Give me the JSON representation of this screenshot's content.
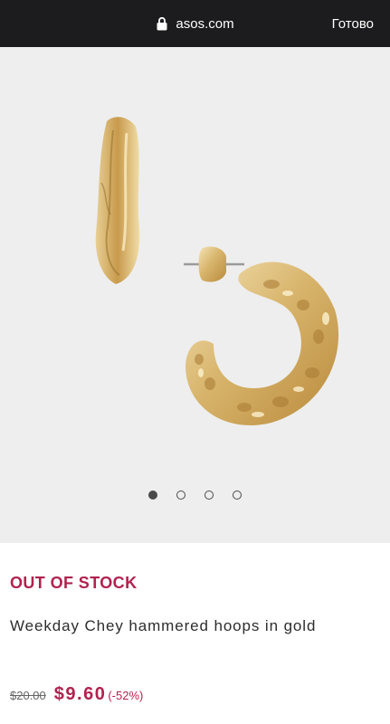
{
  "browser": {
    "url": "asos.com",
    "done_label": "Готово",
    "lock_icon": "lock-icon"
  },
  "gallery": {
    "image_icon": "gold-hoop-earrings-photo",
    "dot_count": 4,
    "active_dot_index": 0
  },
  "product": {
    "stock_status": "OUT OF STOCK",
    "title": "Weekday Chey hammered hoops in gold",
    "old_price": "$20.00",
    "price": "$9.60",
    "discount": "(-52%)"
  },
  "colors": {
    "accent": "#b0234e",
    "topbar": "#1c1c1e",
    "image_background": "#eeeeee"
  }
}
